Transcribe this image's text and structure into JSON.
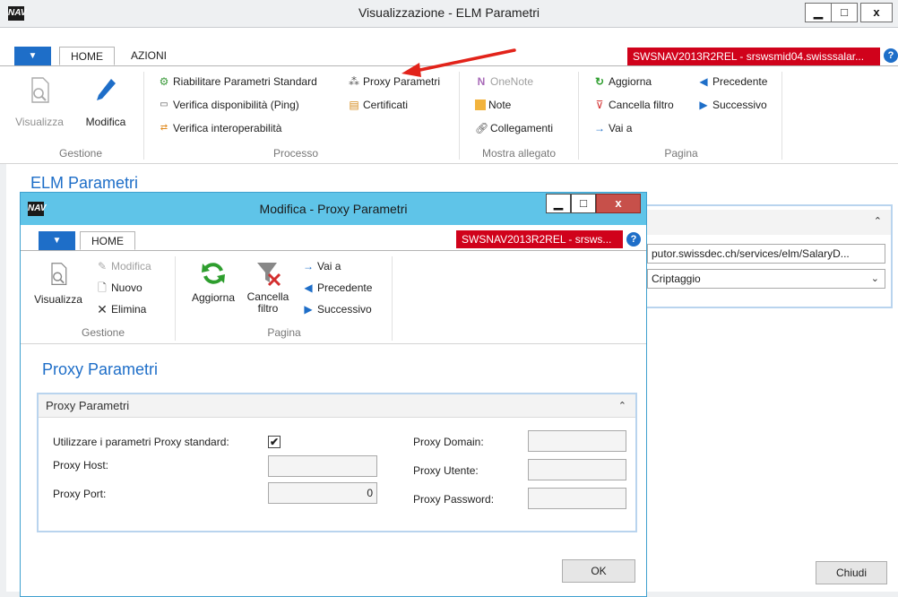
{
  "main": {
    "title": "Visualizzazione - ELM Parametri",
    "logo": "NAV",
    "win_controls": {
      "minimize": "▁",
      "maximize": "□",
      "close": "x"
    },
    "tabs": {
      "file": "▼",
      "home": "HOME",
      "actions": "AZIONI"
    },
    "server_badge": "SWSNAV2013R2REL - srswsmid04.swisssalar...",
    "help": "?",
    "ribbon": {
      "gestione": {
        "label": "Gestione",
        "visualizza": "Visualizza",
        "modifica": "Modifica"
      },
      "processo": {
        "label": "Processo",
        "riabilitare": "Riabilitare Parametri Standard",
        "verifica_ping": "Verifica disponibilità (Ping)",
        "verifica_interop": "Verifica interoperabilità",
        "proxy_parametri": "Proxy Parametri",
        "certificati": "Certificati"
      },
      "mostra_allegato": {
        "label": "Mostra allegato",
        "onenote": "OneNote",
        "note": "Note",
        "collegamenti": "Collegamenti"
      },
      "pagina": {
        "label": "Pagina",
        "aggiorna": "Aggiorna",
        "cancella_filtro": "Cancella filtro",
        "vai_a": "Vai a",
        "precedente": "Precedente",
        "successivo": "Successivo"
      }
    },
    "page_heading": "ELM Parametri",
    "bg_fields": {
      "url": "putor.swissdec.ch/services/elm/SalaryD...",
      "select": "Criptaggio"
    },
    "close_button": "Chiudi"
  },
  "dialog": {
    "title": "Modifica - Proxy Parametri",
    "logo": "NAV",
    "win_controls": {
      "minimize": "▁",
      "maximize": "□",
      "close": "x"
    },
    "tabs": {
      "file": "▼",
      "home": "HOME"
    },
    "server_badge": "SWSNAV2013R2REL - srsws...",
    "help": "?",
    "ribbon": {
      "gestione": {
        "label": "Gestione",
        "visualizza": "Visualizza",
        "modifica": "Modifica",
        "nuovo": "Nuovo",
        "elimina": "Elimina"
      },
      "pagina": {
        "label": "Pagina",
        "aggiorna": "Aggiorna",
        "cancella_filtro_1": "Cancella",
        "cancella_filtro_2": "filtro",
        "vai_a": "Vai a",
        "precedente": "Precedente",
        "successivo": "Successivo"
      }
    },
    "heading": "Proxy Parametri",
    "fasttab_title": "Proxy Parametri",
    "fields": {
      "use_standard_label": "Utilizzare i parametri Proxy standard:",
      "use_standard_checked": "✔",
      "host_label": "Proxy Host:",
      "host_value": "",
      "port_label": "Proxy Port:",
      "port_value": "0",
      "domain_label": "Proxy Domain:",
      "domain_value": "",
      "user_label": "Proxy Utente:",
      "user_value": "",
      "password_label": "Proxy Password:",
      "password_value": ""
    },
    "ok_button": "OK"
  },
  "colors": {
    "accent": "#1e6ec8",
    "server_badge": "#d0021b",
    "dialog_title": "#5fc4e8",
    "arrow": "#e2231a"
  }
}
